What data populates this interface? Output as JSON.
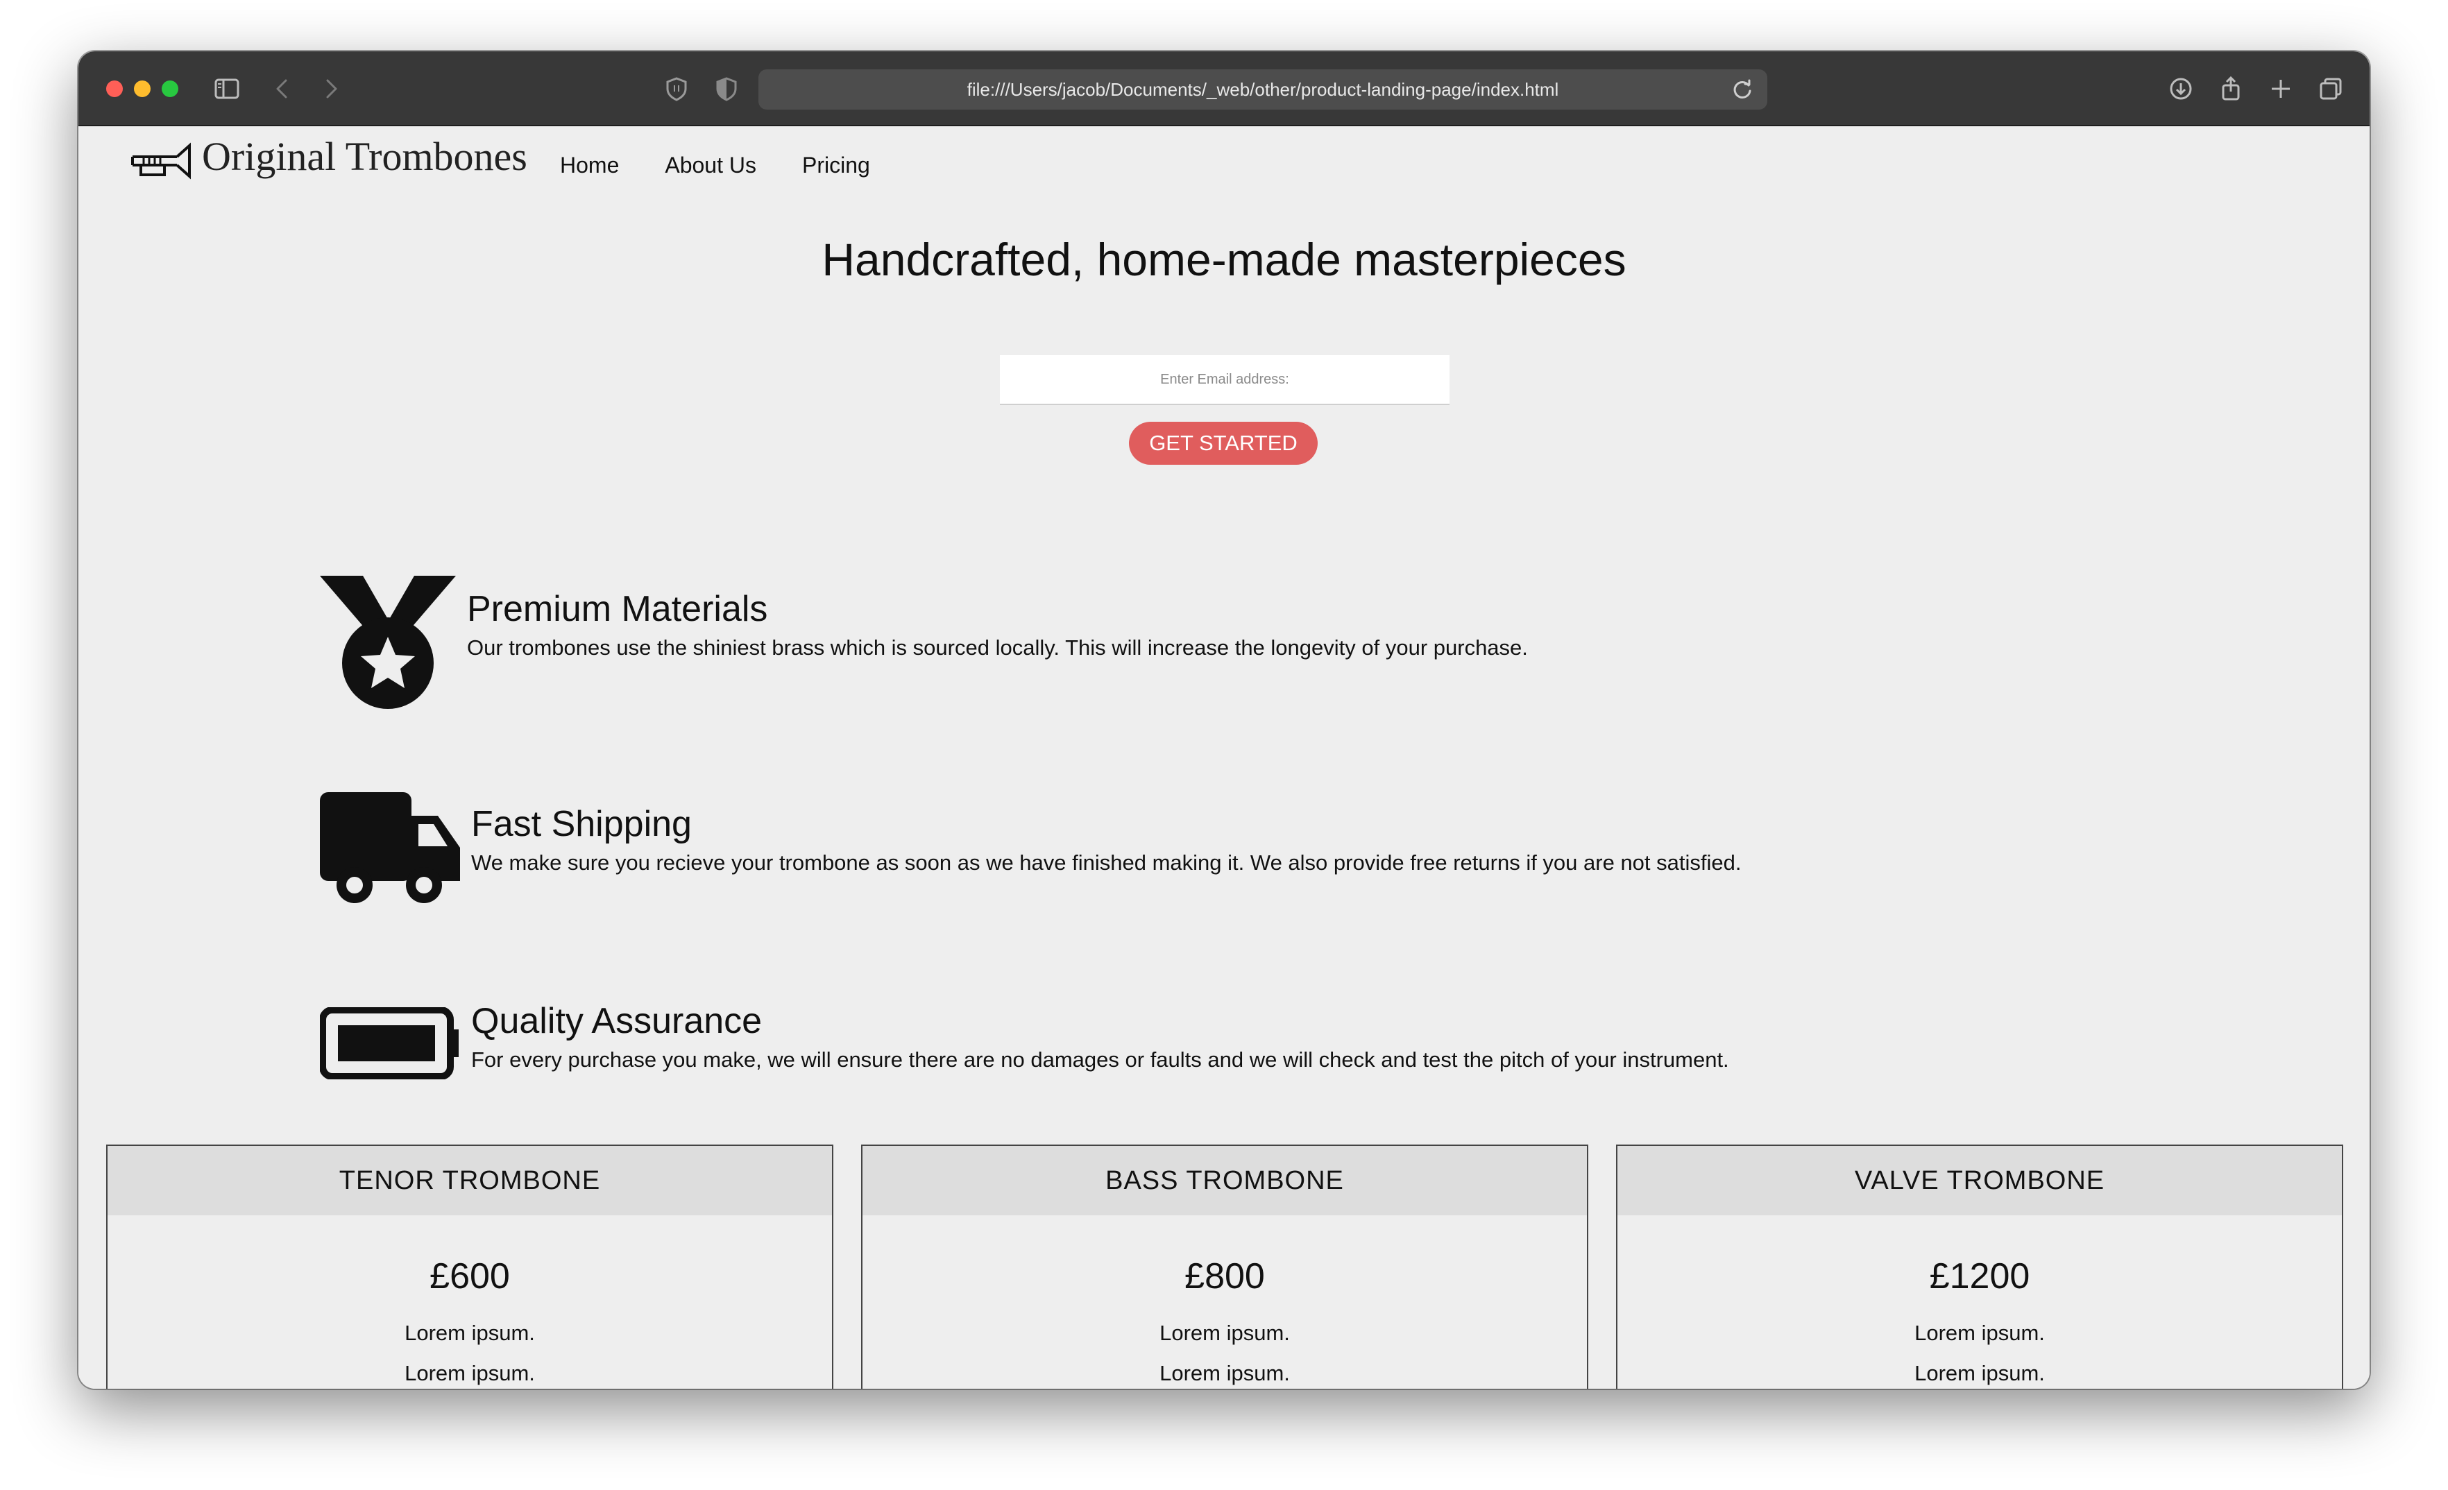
{
  "browser": {
    "url": "file:///Users/jacob/Documents/_web/other/product-landing-page/index.html",
    "icons": [
      "sidebar-icon",
      "back-icon",
      "forward-icon",
      "shield-icon",
      "privacy-icon",
      "reload-icon",
      "download-icon",
      "share-icon",
      "new-tab-icon",
      "tabs-icon"
    ]
  },
  "header": {
    "logo_text": "Original Trombones",
    "logo_icon": "trombone-icon",
    "nav": [
      {
        "label": "Home"
      },
      {
        "label": "About Us"
      },
      {
        "label": "Pricing"
      }
    ]
  },
  "hero": {
    "title": "Handcrafted, home-made masterpieces",
    "email_placeholder": "Enter Email address:",
    "cta_label": "GET STARTED",
    "cta_color": "#e05d5d"
  },
  "features": [
    {
      "icon": "medal-icon",
      "title": "Premium Materials",
      "description": "Our trombones use the shiniest brass which is sourced locally. This will increase the longevity of your purchase."
    },
    {
      "icon": "truck-icon",
      "title": "Fast Shipping",
      "description": "We make sure you recieve your trombone as soon as we have finished making it. We also provide free returns if you are not satisfied."
    },
    {
      "icon": "battery-icon",
      "title": "Quality Assurance",
      "description": "For every purchase you make, we will ensure there are no damages or faults and we will check and test the pitch of your instrument."
    }
  ],
  "pricing": [
    {
      "name": "TENOR TROMBONE",
      "price": "£600",
      "items": [
        "Lorem ipsum.",
        "Lorem ipsum."
      ]
    },
    {
      "name": "BASS TROMBONE",
      "price": "£800",
      "items": [
        "Lorem ipsum.",
        "Lorem ipsum."
      ]
    },
    {
      "name": "VALVE TROMBONE",
      "price": "£1200",
      "items": [
        "Lorem ipsum.",
        "Lorem ipsum."
      ]
    }
  ]
}
